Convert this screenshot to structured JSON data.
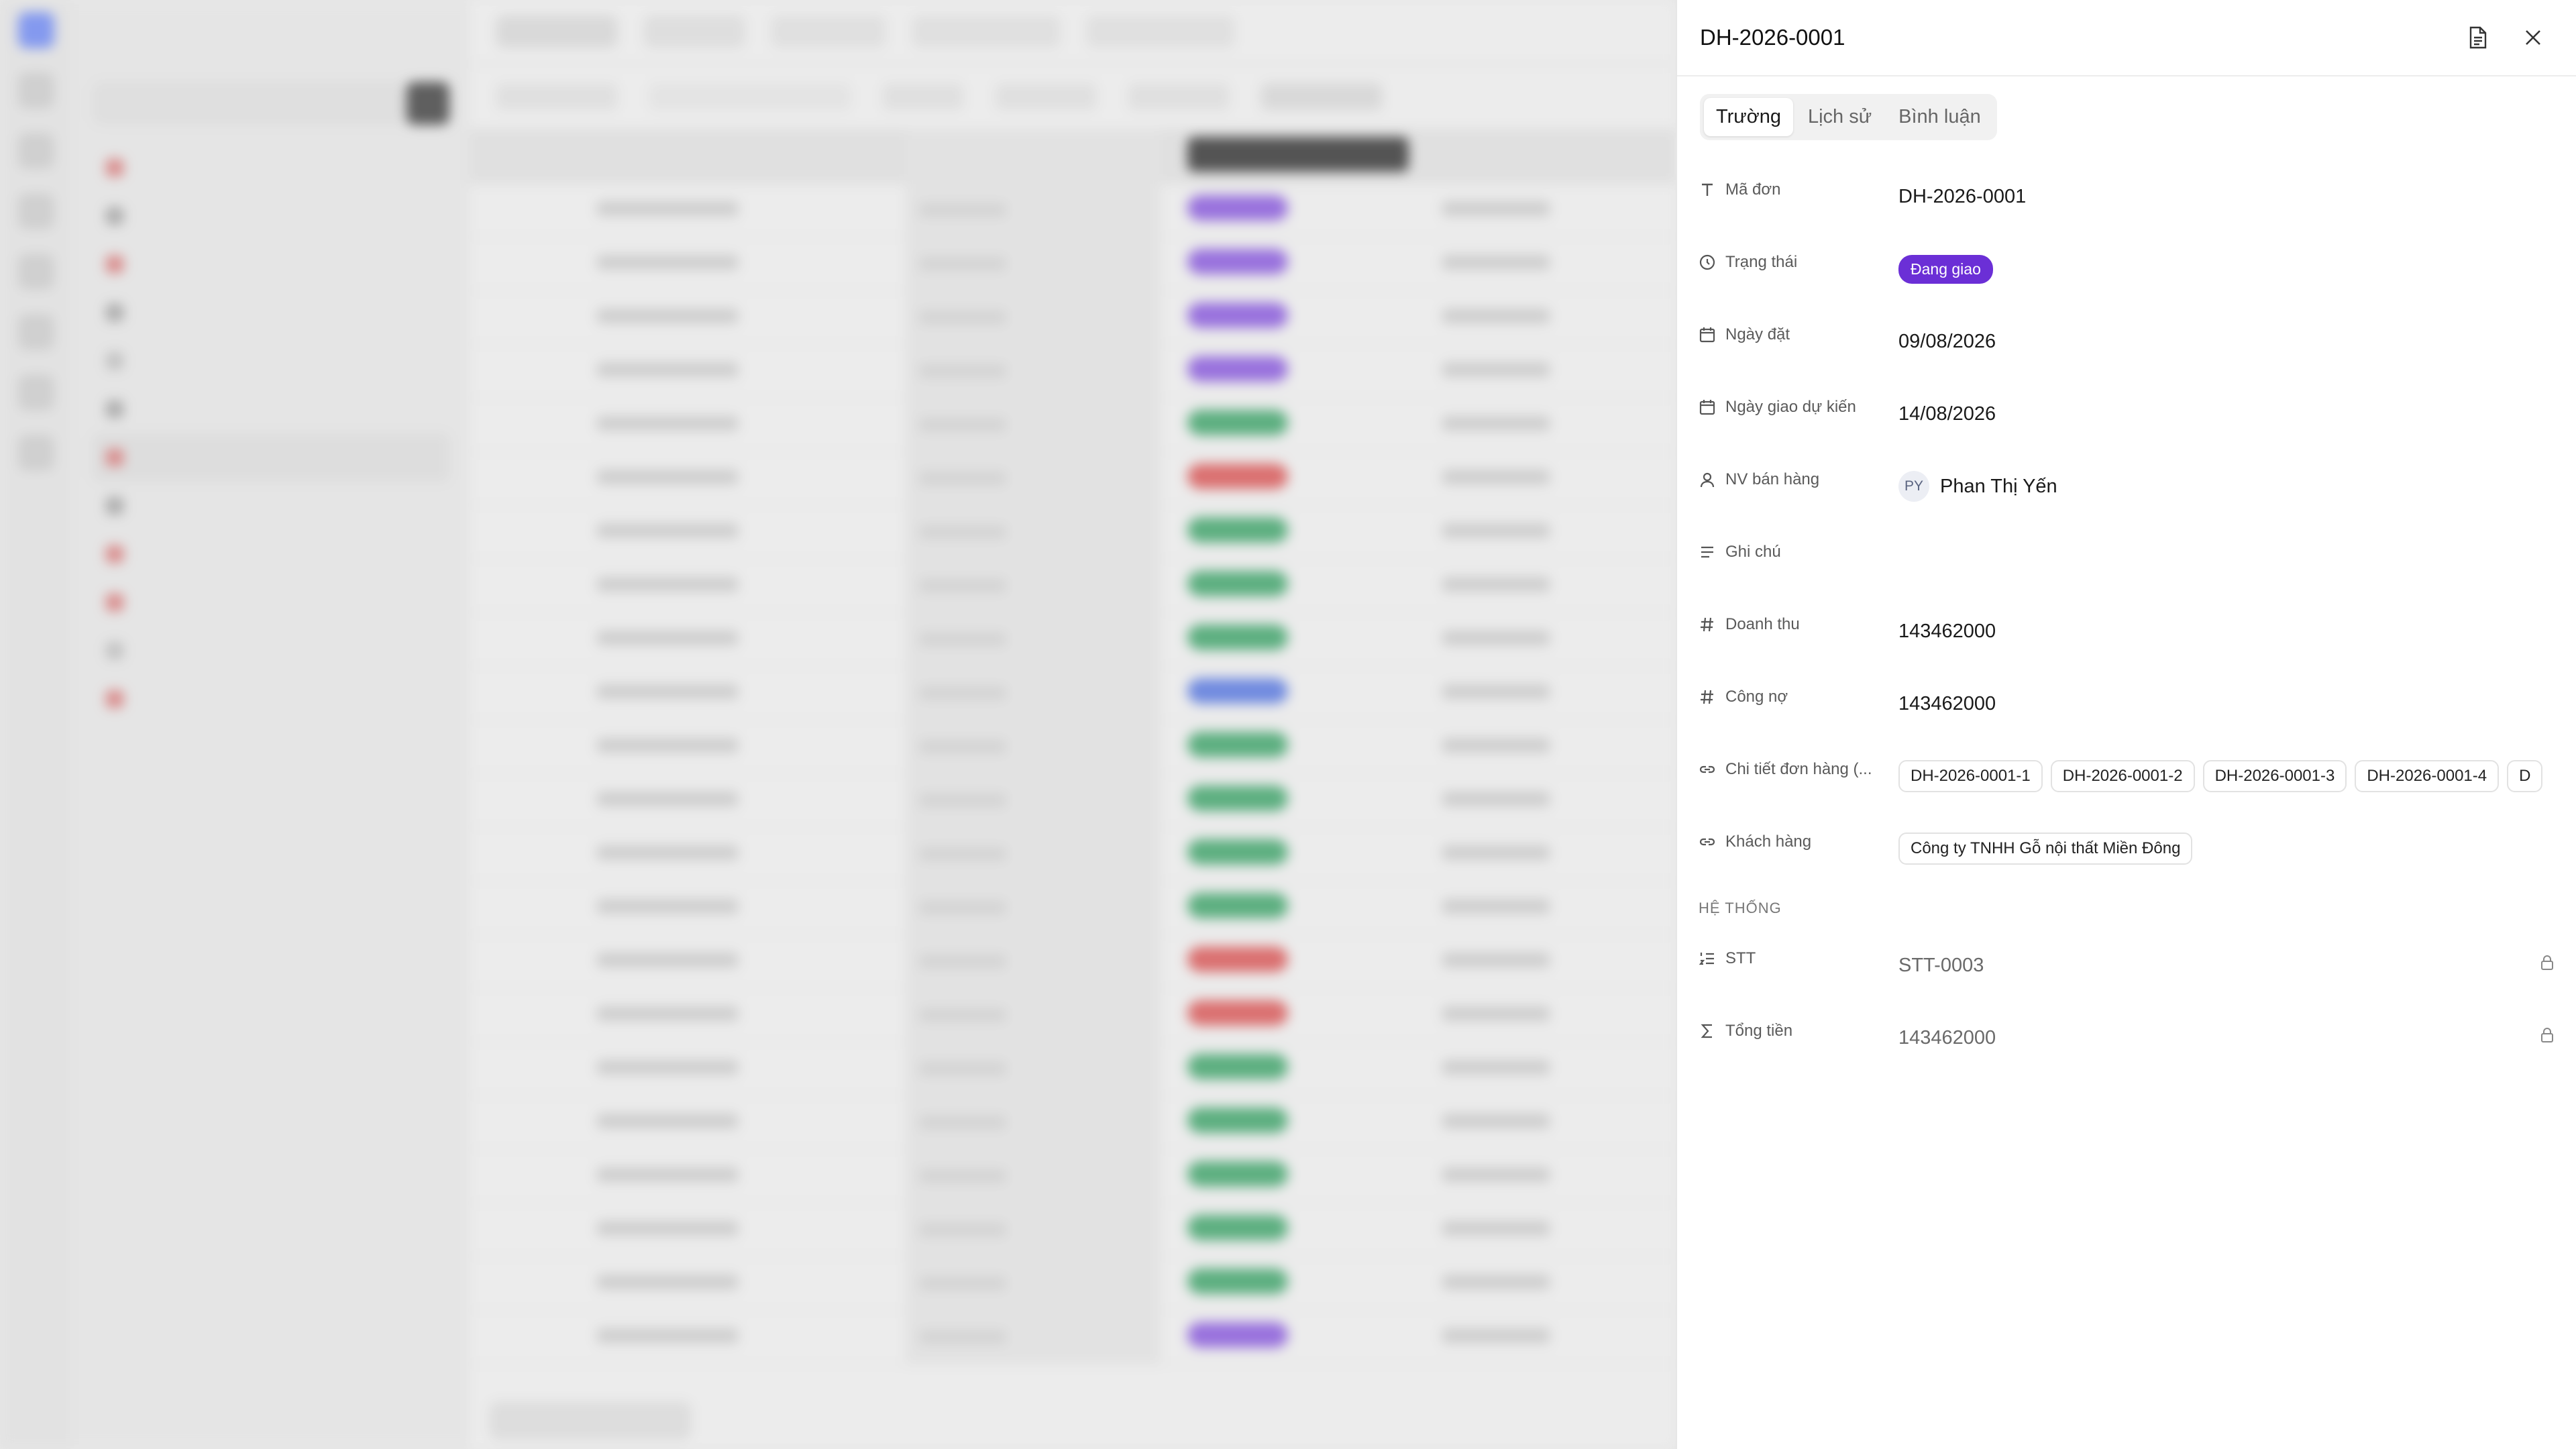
{
  "detail": {
    "title": "DH-2026-0001",
    "tabs": [
      {
        "label": "Trường",
        "active": true
      },
      {
        "label": "Lịch sử",
        "active": false
      },
      {
        "label": "Bình luận",
        "active": false
      }
    ],
    "fields": {
      "ma_don": {
        "label": "Mã đơn",
        "value": "DH-2026-0001",
        "icon": "text-type-icon"
      },
      "trang_thai": {
        "label": "Trạng thái",
        "value": "Đang giao",
        "icon": "status-circle-icon",
        "color": "#6b2fd6"
      },
      "ngay_dat": {
        "label": "Ngày đặt",
        "value": "09/08/2026",
        "icon": "calendar-icon"
      },
      "ngay_giao": {
        "label": "Ngày giao dự kiến",
        "value": "14/08/2026",
        "icon": "calendar-icon"
      },
      "nv_ban_hang": {
        "label": "NV bán hàng",
        "value": "Phan Thị Yến",
        "initials": "PY",
        "icon": "person-icon"
      },
      "ghi_chu": {
        "label": "Ghi chú",
        "value": "",
        "icon": "lines-icon"
      },
      "doanh_thu": {
        "label": "Doanh thu",
        "value": "143462000",
        "icon": "hash-icon"
      },
      "cong_no": {
        "label": "Công nợ",
        "value": "143462000",
        "icon": "hash-icon"
      },
      "chi_tiet": {
        "label": "Chi tiết đơn hàng (...",
        "icon": "link-icon",
        "chips": [
          "DH-2026-0001-1",
          "DH-2026-0001-2",
          "DH-2026-0001-3",
          "DH-2026-0001-4",
          "D"
        ]
      },
      "khach_hang": {
        "label": "Khách hàng",
        "value": "Công ty TNHH Gỗ nội thất Miền Đông",
        "icon": "link-icon"
      }
    },
    "system_section": "HỆ THỐNG",
    "system_fields": {
      "stt": {
        "label": "STT",
        "value": "STT-0003",
        "icon": "numbered-list-icon"
      },
      "tong_tien": {
        "label": "Tổng tiền",
        "value": "143462000",
        "icon": "sigma-icon"
      }
    }
  },
  "colors": {
    "status_purple": "#6b2fd6",
    "pill_green": "#1f9d55",
    "pill_red": "#e03d3d",
    "pill_blue": "#3e66e8"
  }
}
